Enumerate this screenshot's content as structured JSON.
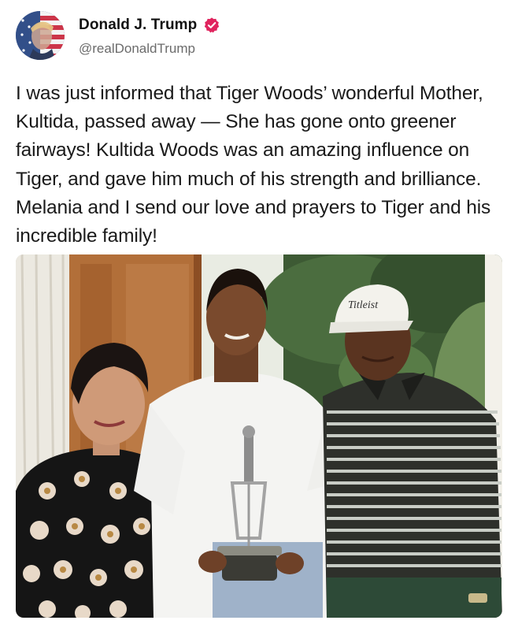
{
  "header": {
    "display_name": "Donald J. Trump",
    "handle": "@realDonaldTrump"
  },
  "post": {
    "text": "I was just informed that Tiger Woods’ wonderful Mother, Kultida, passed away — She has gone onto greener fairways! Kultida Woods was an amazing influence on Tiger, and gave him much of his strength and brilliance. Melania and I send our love and prayers to Tiger and his incredible family!",
    "photo": {
      "cap_logo": "Titleist"
    }
  },
  "icons": {
    "verified": "verified-badge-icon",
    "avatar": "avatar"
  },
  "colors": {
    "verified_badge": "#e0245e",
    "handle": "#6b6b6b",
    "text": "#1a1a1a"
  }
}
